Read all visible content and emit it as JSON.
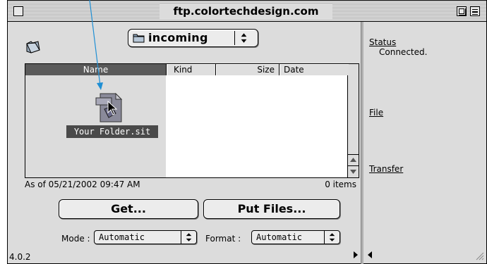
{
  "window": {
    "title": "ftp.colortechdesign.com"
  },
  "folder_popup": {
    "label": "incoming"
  },
  "columns": {
    "name": "Name",
    "kind": "Kind",
    "size": "Size",
    "date": "Date"
  },
  "files": [
    {
      "name": "Your Folder.sit",
      "icon": "stuffit-archive-icon"
    }
  ],
  "status_line": {
    "as_of": "As of 05/21/2002 09:47 AM",
    "items": "0 items"
  },
  "buttons": {
    "get": "Get...",
    "put": "Put Files..."
  },
  "options": {
    "mode_label": "Mode :",
    "mode_value": "Automatic",
    "format_label": "Format :",
    "format_value": "Automatic"
  },
  "version": "4.0.2",
  "right_panel": {
    "status_label": "Status",
    "status_value": "Connected.",
    "file_label": "File",
    "transfer_label": "Transfer"
  },
  "colors": {
    "pointer": "#1f8fd4",
    "selection": "#5a5a5a"
  }
}
